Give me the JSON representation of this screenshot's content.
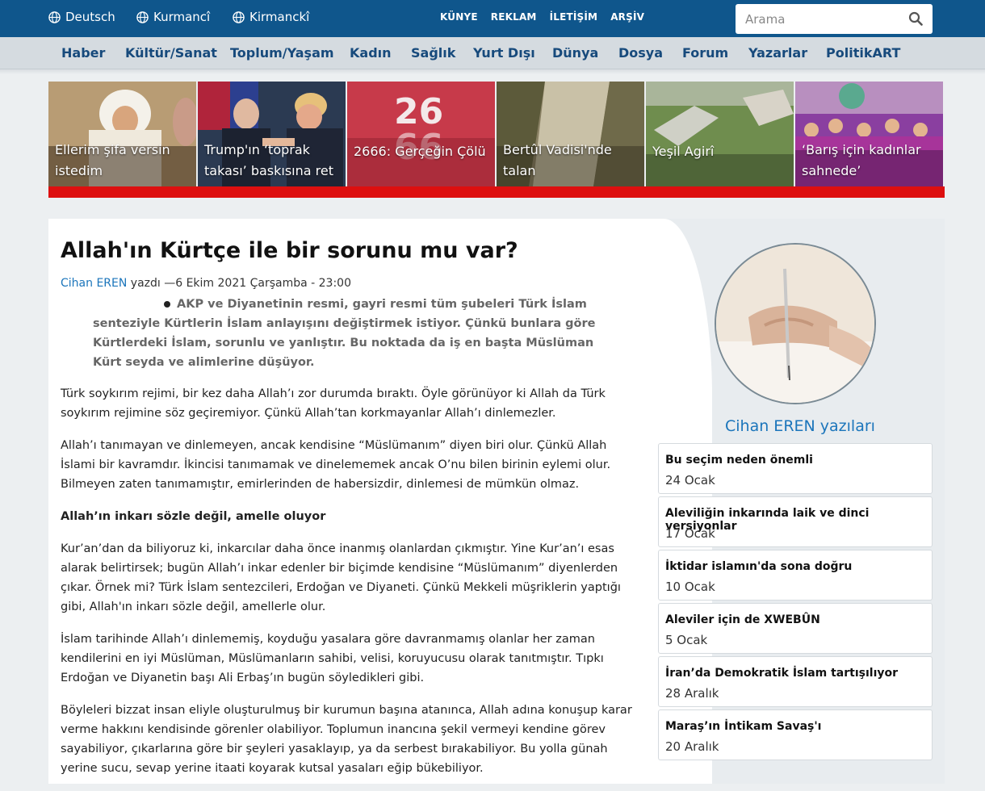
{
  "header": {
    "languages": [
      "Deutsch",
      "Kurmancî",
      "Kirmanckî"
    ],
    "links": [
      "KÜNYE",
      "REKLAM",
      "İLETİŞİM",
      "ARŞİV"
    ],
    "search_placeholder": "Arama"
  },
  "nav": [
    "Haber",
    "Kültür/Sanat",
    "Toplum/Yaşam",
    "Kadın",
    "Sağlık",
    "Yurt Dışı",
    "Dünya",
    "Dosya",
    "Forum",
    "Yazarlar",
    "PolitikART"
  ],
  "featured": [
    {
      "caption": "Ellerim şifa versin istedim"
    },
    {
      "caption": "Trump'ın ‘toprak takası’ baskısına ret"
    },
    {
      "caption": "2666: Gerçeğin Çölü"
    },
    {
      "caption": "Bertûl Vadisi'nde talan"
    },
    {
      "caption": "Yeşil Agirî"
    },
    {
      "caption": "‘Barış için kadınlar sahnede’"
    }
  ],
  "article": {
    "title": "Allah'ın Kürtçe ile bir sorunu mu var?",
    "author": "Cihan EREN",
    "byline_rest": " yazdı —6 Ekim 2021 Çarşamba - 23:00",
    "lead": "AKP ve Diyanetinin resmi, gayri resmi tüm şubeleri Türk İslam senteziyle Kürtlerin İslam anlayışını değiştirmek istiyor. Çünkü bunlara göre Kürtlerdeki İslam, sorunlu ve yanlıştır. Bu noktada da iş en başta Müslüman Kürt seyda ve alimlerine düşüyor.",
    "p1": "Türk soykırım rejimi, bir kez daha Allah’ı zor durumda bıraktı. Öyle görünüyor ki Allah da Türk soykırım rejimine söz geçiremiyor. Çünkü Allah’tan korkmayanlar Allah’ı dinlemezler.",
    "p2": "Allah’ı tanımayan ve dinlemeyen, ancak kendisine “Müslümanım” diyen biri olur. Çünkü Allah İslami bir kavramdır. İkincisi tanımamak ve dinelememek ancak O’nu bilen birinin eylemi olur. Bilmeyen zaten tanımamıştır, emirlerinden de habersizdir, dinlemesi de mümkün olmaz.",
    "h1": "Allah’ın inkarı sözle değil, amelle oluyor",
    "p3": "Kur’an’dan da biliyoruz ki, inkarcılar daha önce inanmış olanlardan çıkmıştır. Yine Kur’an’ı esas alarak belirtirsek; bugün Allah’ı inkar edenler bir biçimde kendisine “Müslümanım” diyenlerden çıkar. Örnek mi? Türk İslam sentezcileri, Erdoğan ve Diyaneti. Çünkü Mekkeli müşriklerin yaptığı gibi, Allah'ın inkarı sözle değil, amellerle olur.",
    "p4": "İslam tarihinde Allah’ı dinlememiş, koyduğu yasalara göre davranmamış olanlar her zaman kendilerini en iyi Müslüman, Müslümanların sahibi, velisi, koruyucusu olarak tanıtmıştır. Tıpkı Erdoğan ve Diyanetin başı Ali Erbaş’ın bugün söyledikleri gibi.",
    "p5": "Böyleleri bizzat insan eliyle oluşturulmuş bir kurumun başına atanınca, Allah adına konuşup karar verme hakkını kendisinde görenler olabiliyor. Toplumun inancına şekil vermeyi kendine görev sayabiliyor, çıkarlarına göre bir şeyleri yasaklayıp, ya da serbest bırakabiliyor. Bu yolla günah yerine sucu, sevap yerine itaati koyarak kutsal yasaları eğip bükebiliyor."
  },
  "sidebar": {
    "heading": "Cihan EREN yazıları",
    "posts": [
      {
        "title": "Bu seçim neden önemli",
        "date": "24 Ocak"
      },
      {
        "title": "Aleviliğin inkarında laik ve dinci versiyonlar",
        "date": "17 Ocak"
      },
      {
        "title": "İktidar islamın'da sona doğru",
        "date": "10 Ocak"
      },
      {
        "title": "Aleviler için de XWEBÛN",
        "date": "5 Ocak"
      },
      {
        "title": "İran’da Demokratik İslam tartışılıyor",
        "date": "28 Aralık"
      },
      {
        "title": "Maraş’ın İntikam Savaş'ı",
        "date": "20 Aralık"
      }
    ]
  },
  "colors": {
    "topbar": "#0f568c",
    "nav_text": "#174a7c",
    "accent_red": "#dd0f0f",
    "link": "#1b75bb"
  }
}
